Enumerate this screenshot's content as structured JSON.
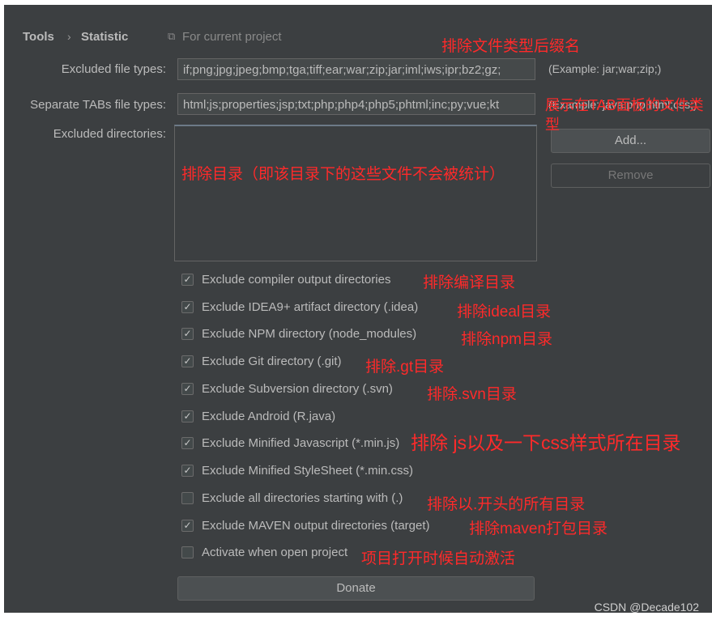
{
  "breadcrumb": {
    "root": "Tools",
    "separator": "›",
    "current": "Statistic",
    "scope_icon": "copy-icon",
    "scope": "For current project"
  },
  "excluded_file_types": {
    "label": "Excluded file types:",
    "value": "if;png;jpg;jpeg;bmp;tga;tiff;ear;war;zip;jar;iml;iws;ipr;bz2;gz;",
    "example": "(Example: jar;war;zip;)"
  },
  "separate_tabs": {
    "label": "Separate TABs file types:",
    "value": "html;js;properties;jsp;txt;php;php4;php5;phtml;inc;py;vue;kt",
    "example": "(Example: java;php;html;css;)"
  },
  "excluded_dirs": {
    "label": "Excluded directories:",
    "add": "Add...",
    "remove": "Remove"
  },
  "options": [
    {
      "label": "Exclude compiler output directories",
      "checked": true
    },
    {
      "label": "Exclude IDEA9+ artifact directory (.idea)",
      "checked": true
    },
    {
      "label": "Exclude NPM directory (node_modules)",
      "checked": true
    },
    {
      "label": "Exclude Git directory (.git)",
      "checked": true
    },
    {
      "label": "Exclude Subversion directory (.svn)",
      "checked": true
    },
    {
      "label": "Exclude Android (R.java)",
      "checked": true
    },
    {
      "label": "Exclude Minified Javascript (*.min.js)",
      "checked": true
    },
    {
      "label": "Exclude Minified StyleSheet (*.min.css)",
      "checked": true
    },
    {
      "label": "Exclude all directories starting with (.)",
      "checked": false
    },
    {
      "label": "Exclude MAVEN output directories (target)",
      "checked": true
    },
    {
      "label": "Activate when open project",
      "checked": false
    }
  ],
  "donate": "Donate",
  "annotations": {
    "file_types": "排除文件类型后缀名",
    "tabs": "展示在TAB面板的文件类型",
    "dirs": "排除目录（即该目录下的这些文件不会被统计）",
    "compiler": "排除编译目录",
    "idea": "排除ideal目录",
    "npm": "排除npm目录",
    "git": "排除.gt目录",
    "svn": "排除.svn目录",
    "minjs": "排除 js以及一下css样式所在目录",
    "dot": "排除以.开头的所有目录",
    "maven": "排除maven打包目录",
    "activate": "项目打开时候自动激活"
  },
  "watermark": "CSDN @Decade102",
  "colors": {
    "background": "#3c3f41",
    "annotation": "#ff2a2a",
    "text": "#bbbbbb"
  }
}
